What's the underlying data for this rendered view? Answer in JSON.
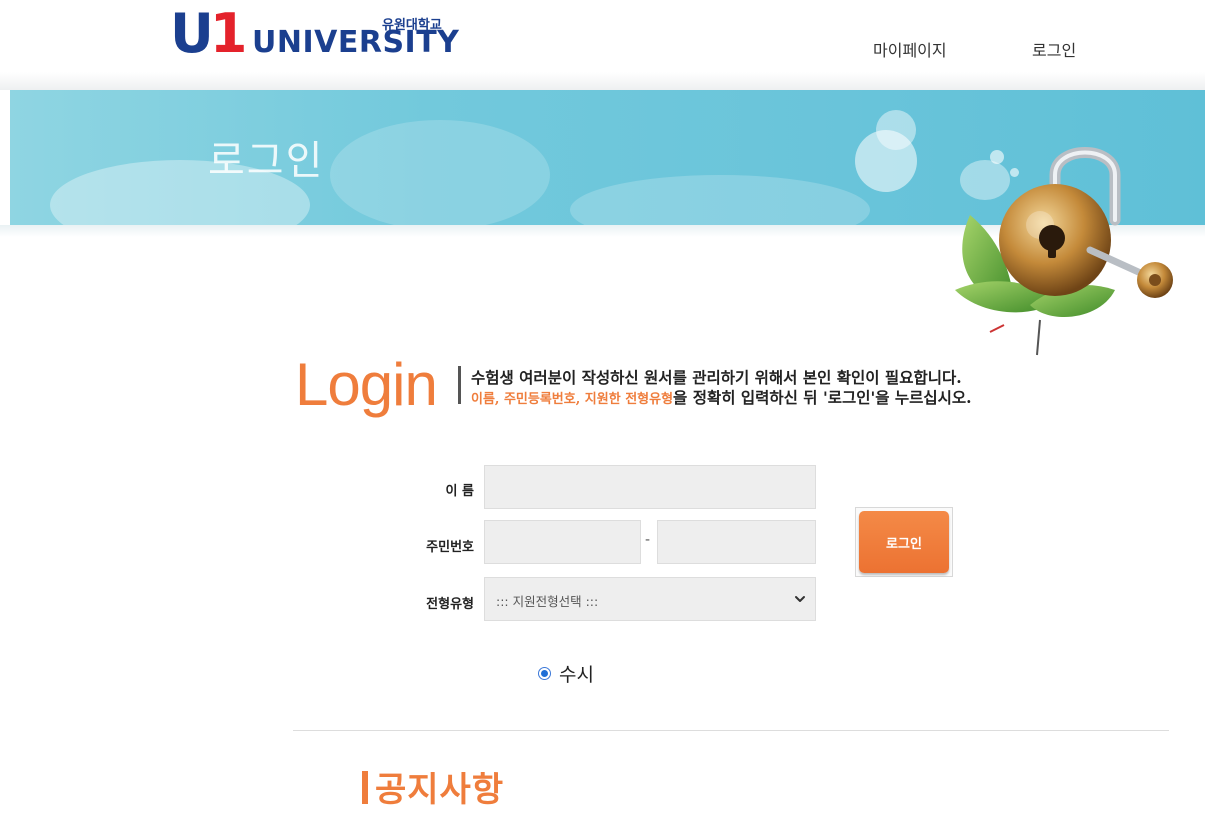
{
  "header": {
    "logo_mark": "U1",
    "logo_text": "UNIVERSITY",
    "logo_korean": "유원대학교",
    "nav": [
      {
        "label": "마이페이지"
      },
      {
        "label": "로그인"
      }
    ]
  },
  "banner": {
    "title": "로그인"
  },
  "intro": {
    "heading": "Login",
    "line1": "수험생 여러분이 작성하신 원서를 관리하기 위해서 본인 확인이 필요합니다.",
    "line2_highlight": "이름, 주민등록번호, 지원한 전형유형",
    "line2_rest": "을 정확히 입력하신 뒤 '로그인'을 누르십시오."
  },
  "form": {
    "name_label": "이 름",
    "name_value": "",
    "ssn_label": "주민번호",
    "ssn_first_value": "",
    "ssn_separator": "-",
    "ssn_second_value": "",
    "type_label": "전형유형",
    "type_selected": "::: 지원전형선택 :::",
    "login_button": "로그인",
    "radio_label": "수시",
    "radio_checked": true
  },
  "notice": {
    "title": "공지사항"
  },
  "colors": {
    "accent": "#ef7d3c",
    "brand_blue": "#1b3f8f",
    "brand_red": "#e4222b",
    "banner": "#6fc7db"
  }
}
